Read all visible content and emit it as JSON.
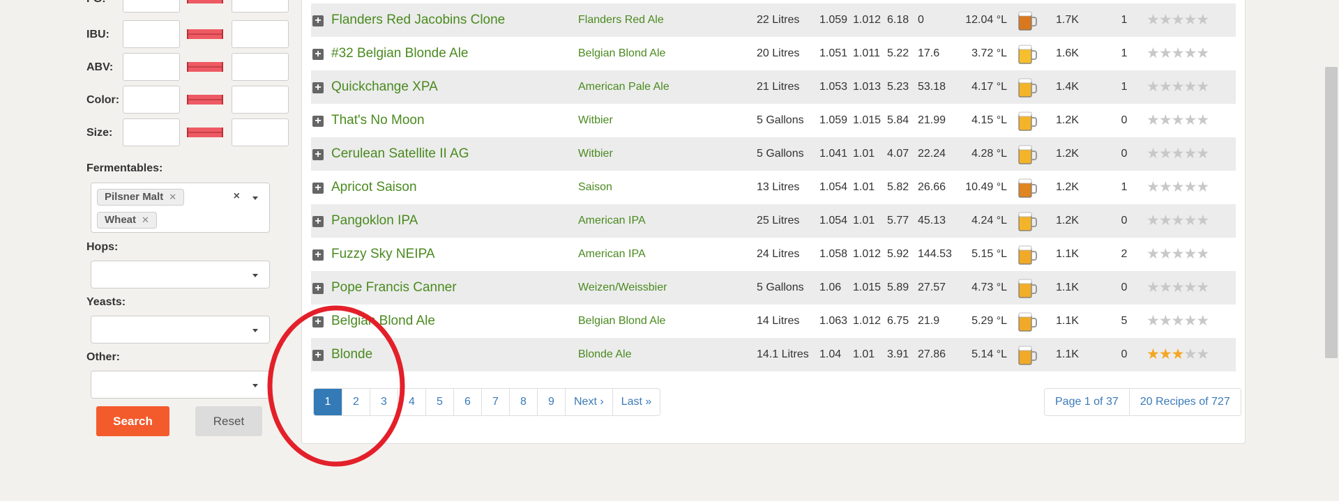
{
  "filters": {
    "ranges": [
      {
        "label": "FG:"
      },
      {
        "label": "IBU:"
      },
      {
        "label": "ABV:"
      },
      {
        "label": "Color:"
      },
      {
        "label": "Size:"
      }
    ],
    "fermentables_label": "Fermentables:",
    "fermentables_tags": [
      "Pilsner Malt",
      "Wheat"
    ],
    "hops_label": "Hops:",
    "yeasts_label": "Yeasts:",
    "other_label": "Other:",
    "search_label": "Search",
    "reset_label": "Reset"
  },
  "recipes": [
    {
      "name": "Flanders Red Jacobins Clone",
      "style": "Flanders Red Ale",
      "size": "22 Litres",
      "og": "1.059",
      "fg": "1.012",
      "abv": "6.18",
      "ibu": "0",
      "color": "12.04 °L",
      "mug_color": "#d9781e",
      "views": "1.7K",
      "brewed": "1",
      "rating": 0
    },
    {
      "name": "#32 Belgian Blonde Ale",
      "style": "Belgian Blond Ale",
      "size": "20 Litres",
      "og": "1.051",
      "fg": "1.011",
      "abv": "5.22",
      "ibu": "17.6",
      "color": "3.72 °L",
      "mug_color": "#f7bf2e",
      "views": "1.6K",
      "brewed": "1",
      "rating": 0
    },
    {
      "name": "Quickchange XPA",
      "style": "American Pale Ale",
      "size": "21 Litres",
      "og": "1.053",
      "fg": "1.013",
      "abv": "5.23",
      "ibu": "53.18",
      "color": "4.17 °L",
      "mug_color": "#f4b42a",
      "views": "1.4K",
      "brewed": "1",
      "rating": 0
    },
    {
      "name": "That's No Moon",
      "style": "Witbier",
      "size": "5 Gallons",
      "og": "1.059",
      "fg": "1.015",
      "abv": "5.84",
      "ibu": "21.99",
      "color": "4.15 °L",
      "mug_color": "#f4b42a",
      "views": "1.2K",
      "brewed": "0",
      "rating": 0
    },
    {
      "name": "Cerulean Satellite II AG",
      "style": "Witbier",
      "size": "5 Gallons",
      "og": "1.041",
      "fg": "1.01",
      "abv": "4.07",
      "ibu": "22.24",
      "color": "4.28 °L",
      "mug_color": "#f4b42a",
      "views": "1.2K",
      "brewed": "0",
      "rating": 0
    },
    {
      "name": "Apricot Saison",
      "style": "Saison",
      "size": "13 Litres",
      "og": "1.054",
      "fg": "1.01",
      "abv": "5.82",
      "ibu": "26.66",
      "color": "10.49 °L",
      "mug_color": "#e0851f",
      "views": "1.2K",
      "brewed": "1",
      "rating": 0
    },
    {
      "name": "Pangoklon IPA",
      "style": "American IPA",
      "size": "25 Litres",
      "og": "1.054",
      "fg": "1.01",
      "abv": "5.77",
      "ibu": "45.13",
      "color": "4.24 °L",
      "mug_color": "#f4b42a",
      "views": "1.2K",
      "brewed": "0",
      "rating": 0
    },
    {
      "name": "Fuzzy Sky NEIPA",
      "style": "American IPA",
      "size": "24 Litres",
      "og": "1.058",
      "fg": "1.012",
      "abv": "5.92",
      "ibu": "144.53",
      "color": "5.15 °L",
      "mug_color": "#f1aa28",
      "views": "1.1K",
      "brewed": "2",
      "rating": 0
    },
    {
      "name": "Pope Francis Canner",
      "style": "Weizen/Weissbier",
      "size": "5 Gallons",
      "og": "1.06",
      "fg": "1.015",
      "abv": "5.89",
      "ibu": "27.57",
      "color": "4.73 °L",
      "mug_color": "#f2ae29",
      "views": "1.1K",
      "brewed": "0",
      "rating": 0
    },
    {
      "name": "Belgian Blond Ale",
      "style": "Belgian Blond Ale",
      "size": "14 Litres",
      "og": "1.063",
      "fg": "1.012",
      "abv": "6.75",
      "ibu": "21.9",
      "color": "5.29 °L",
      "mug_color": "#f1aa28",
      "views": "1.1K",
      "brewed": "5",
      "rating": 0
    },
    {
      "name": "Blonde",
      "style": "Blonde Ale",
      "size": "14.1 Litres",
      "og": "1.04",
      "fg": "1.01",
      "abv": "3.91",
      "ibu": "27.86",
      "color": "5.14 °L",
      "mug_color": "#f1aa28",
      "views": "1.1K",
      "brewed": "0",
      "rating": 3
    }
  ],
  "pagination": {
    "pages": [
      "1",
      "2",
      "3",
      "4",
      "5",
      "6",
      "7",
      "8",
      "9"
    ],
    "active": "1",
    "next_label": "Next ›",
    "last_label": "Last »",
    "page_info": "Page 1 of 37",
    "count_info": "20 Recipes of 727"
  },
  "colors": {
    "accent_green": "#4a8a1f",
    "search_orange": "#f35a2c",
    "annotation_red": "#e3202a",
    "page_blue": "#337ab7"
  }
}
